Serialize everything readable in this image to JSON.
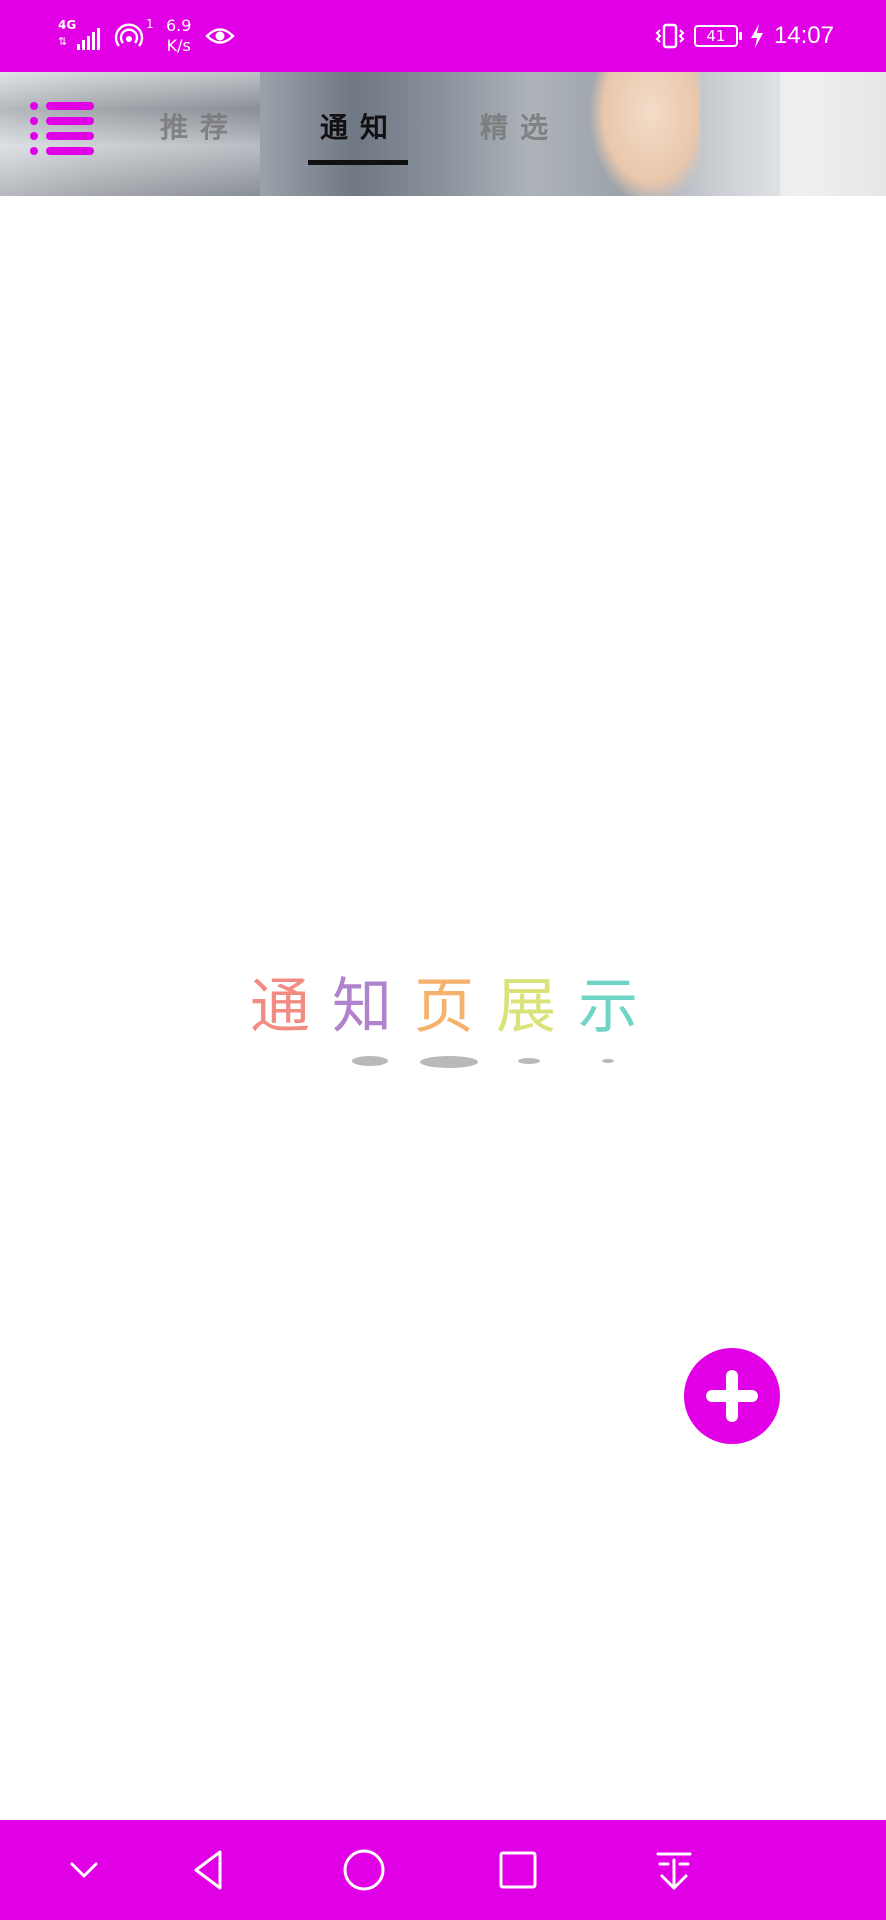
{
  "status_bar": {
    "network_type": "4G",
    "net_arrows": "⇅",
    "sim_index": "1",
    "speed_value": "6.9",
    "speed_unit": "K/s",
    "battery": "41",
    "time": "14:07",
    "icons": [
      "signal-icon",
      "hotspot-icon",
      "eye-icon",
      "vibrate-icon",
      "battery-icon",
      "charging-icon"
    ]
  },
  "header": {
    "menu_icon": "list-menu-icon",
    "tabs": [
      {
        "label": "推荐",
        "active": false
      },
      {
        "label": "通知",
        "active": true
      },
      {
        "label": "精选",
        "active": false
      }
    ]
  },
  "main": {
    "title_chars": [
      "通",
      "知",
      "页",
      "展",
      "示"
    ],
    "title_colors": [
      "#F28B82",
      "#B084CC",
      "#F6B26B",
      "#D9E37A",
      "#6FD6C6"
    ]
  },
  "fab": {
    "icon": "plus-icon",
    "color": "#E100E6"
  },
  "nav_bar": {
    "color": "#E100E6",
    "buttons": [
      "chevron-down-icon",
      "back-triangle-icon",
      "home-circle-icon",
      "recents-square-icon",
      "pull-down-icon"
    ]
  }
}
